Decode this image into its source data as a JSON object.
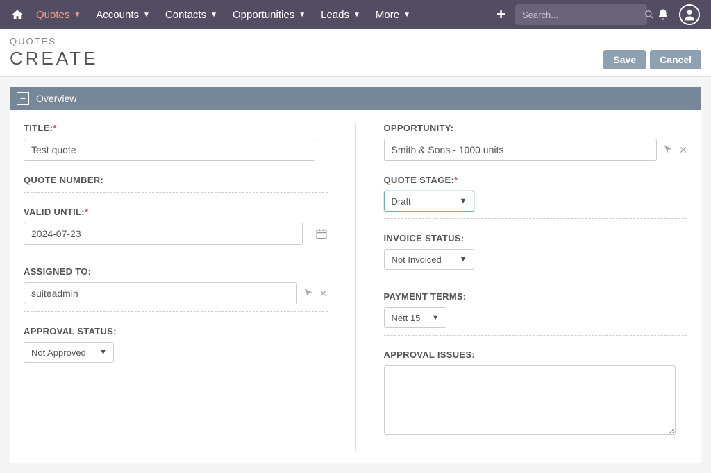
{
  "nav": {
    "items": [
      {
        "label": "Quotes",
        "active": true
      },
      {
        "label": "Accounts"
      },
      {
        "label": "Contacts"
      },
      {
        "label": "Opportunities"
      },
      {
        "label": "Leads"
      },
      {
        "label": "More"
      }
    ],
    "search_placeholder": "Search..."
  },
  "header": {
    "module": "QUOTES",
    "action": "CREATE",
    "save": "Save",
    "cancel": "Cancel"
  },
  "panel": {
    "overview": "Overview"
  },
  "labels": {
    "title": "TITLE:",
    "opportunity": "OPPORTUNITY:",
    "quote_number": "QUOTE NUMBER:",
    "quote_stage": "QUOTE STAGE:",
    "valid_until": "VALID UNTIL:",
    "invoice_status": "INVOICE STATUS:",
    "assigned_to": "ASSIGNED TO:",
    "payment_terms": "PAYMENT TERMS:",
    "approval_status": "APPROVAL STATUS:",
    "approval_issues": "APPROVAL ISSUES:"
  },
  "values": {
    "title": "Test quote",
    "opportunity": "Smith & Sons - 1000 units",
    "quote_stage": "Draft",
    "valid_until": "2024-07-23",
    "invoice_status": "Not Invoiced",
    "assigned_to": "suiteadmin",
    "payment_terms": "Nett 15",
    "approval_status": "Not Approved",
    "approval_issues": ""
  }
}
